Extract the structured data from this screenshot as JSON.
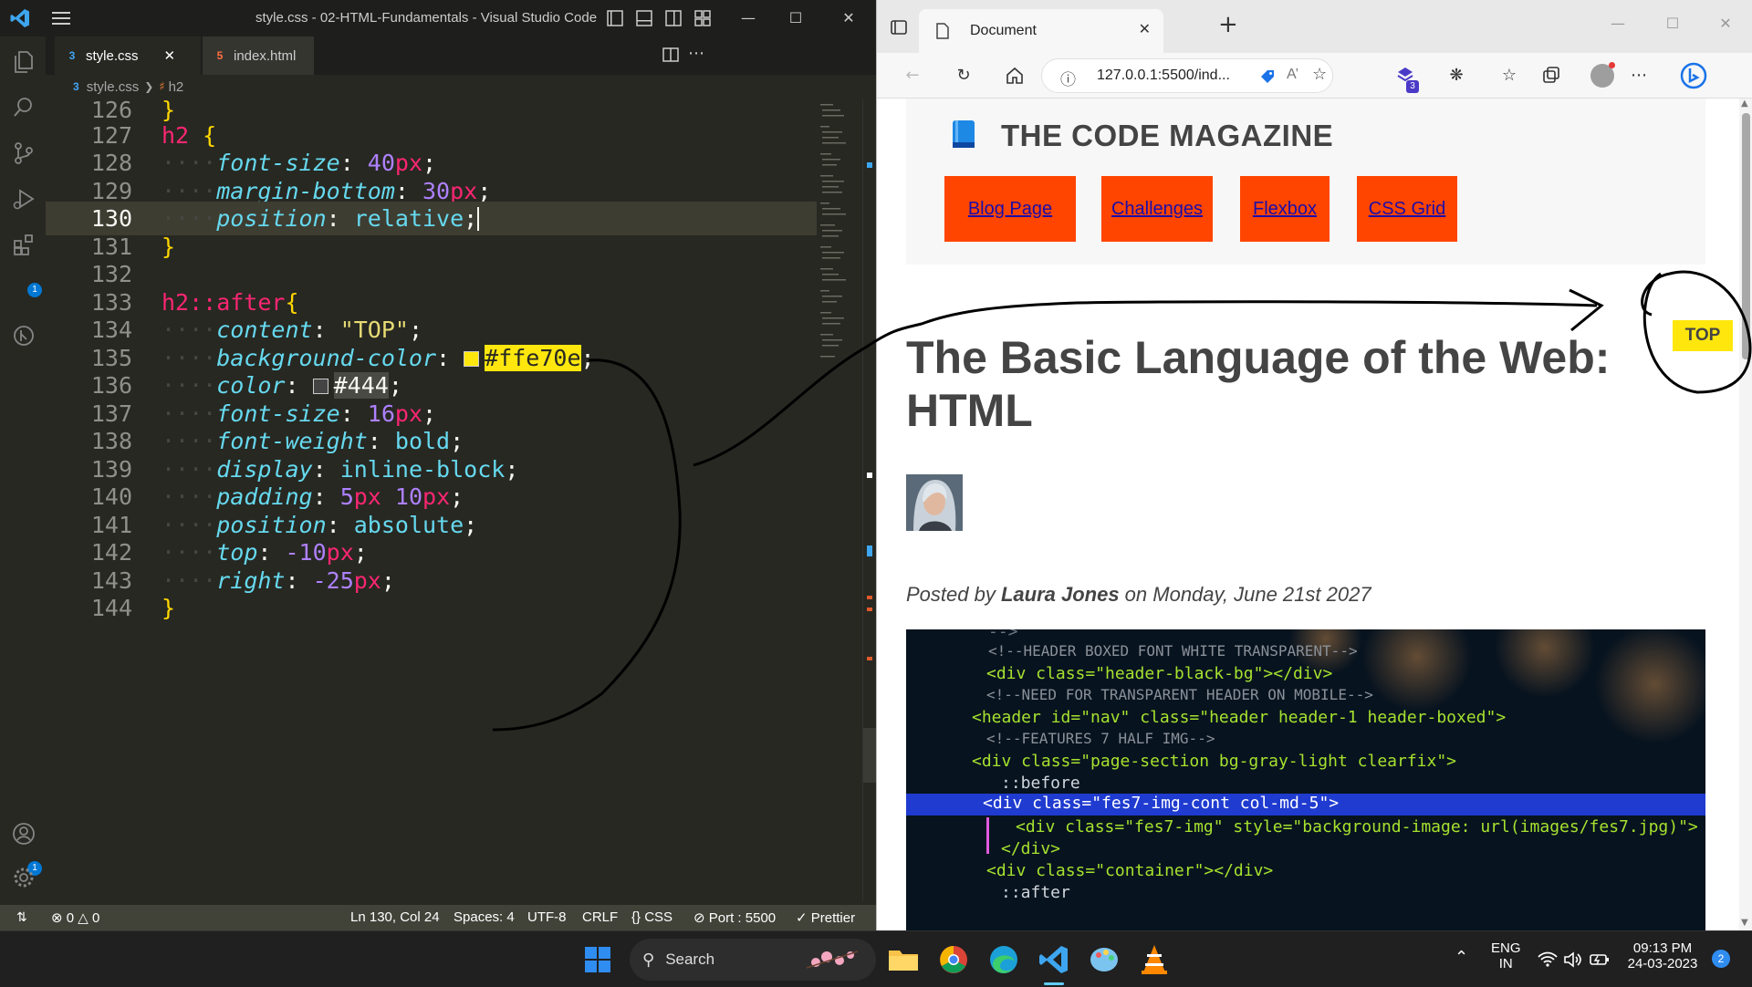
{
  "vscode": {
    "title": "style.css - 02-HTML-Fundamentals - Visual Studio Code",
    "tabs": [
      {
        "label": "style.css",
        "icon": "css-file-icon",
        "active": true
      },
      {
        "label": "index.html",
        "icon": "html-file-icon",
        "active": false
      }
    ],
    "breadcrumb": {
      "file": "style.css",
      "symbol": "h2"
    },
    "activity_badges": {
      "extensions": "1",
      "accounts": "1"
    },
    "lines": [
      {
        "n": "126"
      },
      {
        "n": "127",
        "sel": "h2",
        "brace_open": "{"
      },
      {
        "n": "128",
        "prop": "font-size",
        "num": "40",
        "unit": "px"
      },
      {
        "n": "129",
        "prop": "margin-bottom",
        "num": "30",
        "unit": "px"
      },
      {
        "n": "130",
        "prop": "position",
        "val": "relative"
      },
      {
        "n": "131",
        "brace_close": "}"
      },
      {
        "n": "132"
      },
      {
        "n": "133",
        "sel": "h2::after",
        "brace_open": "{"
      },
      {
        "n": "134",
        "prop": "content",
        "val": "\"TOP\""
      },
      {
        "n": "135",
        "prop": "background-color",
        "val": "#ffe70e",
        "swatch": "#ffe70e"
      },
      {
        "n": "136",
        "prop": "color",
        "val": "#444",
        "swatch": "#444444"
      },
      {
        "n": "137",
        "prop": "font-size",
        "num": "16",
        "unit": "px"
      },
      {
        "n": "138",
        "prop": "font-weight",
        "val": "bold"
      },
      {
        "n": "139",
        "prop": "display",
        "val": "inline-block"
      },
      {
        "n": "140",
        "prop": "padding",
        "num": "5",
        "unit": "px",
        "num2": "10",
        "unit2": "px"
      },
      {
        "n": "141",
        "prop": "position",
        "val": "absolute"
      },
      {
        "n": "142",
        "prop": "top",
        "num": "-10",
        "unit": "px"
      },
      {
        "n": "143",
        "prop": "right",
        "num": "-25",
        "unit": "px"
      },
      {
        "n": "144",
        "brace_close": "}"
      }
    ],
    "status": {
      "errors": "0",
      "warnings": "0",
      "position": "Ln 130, Col 24",
      "spaces": "Spaces: 4",
      "encoding": "UTF-8",
      "eol": "CRLF",
      "language": "CSS",
      "port": "Port : 5500",
      "formatter": "Prettier"
    }
  },
  "edge": {
    "tab_title": "Document",
    "url": "127.0.0.1:5500/ind...",
    "extensions_badge": "3"
  },
  "page": {
    "brand": "THE CODE MAGAZINE",
    "nav": [
      "Blog Page",
      "Challenges",
      "Flexbox",
      "CSS Grid"
    ],
    "title_line1": "The Basic Language of the Web:",
    "title_line2": "HTML",
    "top_badge": "TOP",
    "posted_prefix": "Posted by ",
    "author": "Laura Jones",
    "posted_suffix": " on Monday, June 21st 2027",
    "hero_code": [
      "-->",
      "<!--HEADER BOXED FONT WHITE TRANSPARENT-->",
      "<div class=\"header-black-bg\"></div>",
      "<!--NEED FOR TRANSPARENT HEADER ON MOBILE-->",
      "<header id=\"nav\" class=\"header header-1 header-boxed\">",
      "<!--FEATURES 7 HALF IMG-->",
      "<div class=\"page-section bg-gray-light clearfix\">",
      "::before",
      "<div class=\"fes7-img-cont col-md-5\">",
      "<div class=\"fes7-img\" style=\"background-image: url(images/fes7.jpg)\">",
      "</div>",
      "<div class=\"container\"></div>",
      "::after"
    ]
  },
  "taskbar": {
    "search_label": "Search",
    "lang": "ENG",
    "region": "IN",
    "time": "09:13 PM",
    "date": "24-03-2023",
    "notifications": "2"
  },
  "colors": {
    "accent_yellow": "#ffe70e",
    "nav_orange": "#ff4500",
    "vscode_bg": "#272822"
  }
}
